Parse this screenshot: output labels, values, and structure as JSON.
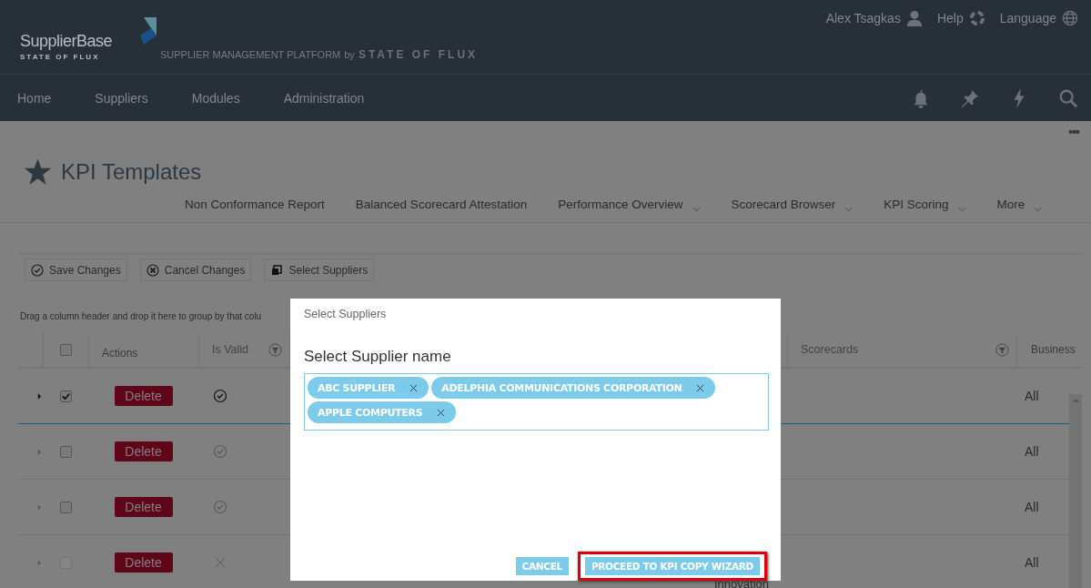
{
  "header": {
    "logo": {
      "name": "SupplierBase",
      "sub": "STATE OF FLUX"
    },
    "tagline": "SUPPLIER MANAGEMENT PLATFORM",
    "tagline_by": "by",
    "tagline_brand": "STATE OF FLUX",
    "user_links": [
      "Alex Tsagkas",
      "Help",
      "Language"
    ]
  },
  "nav": {
    "items": [
      "Home",
      "Suppliers",
      "Modules",
      "Administration"
    ]
  },
  "page": {
    "more": "•••",
    "title": "KPI Templates",
    "tabs": [
      {
        "label": "Non Conformance Report",
        "has_menu": false
      },
      {
        "label": "Balanced Scorecard Attestation",
        "has_menu": false
      },
      {
        "label": "Performance Overview",
        "has_menu": true
      },
      {
        "label": "Scorecard Browser",
        "has_menu": true
      },
      {
        "label": "KPI Scoring",
        "has_menu": true
      },
      {
        "label": "More",
        "has_menu": true
      }
    ],
    "toolbar": [
      "Save Changes",
      "Cancel Changes",
      "Select Suppliers"
    ],
    "group_hint": "Drag a column header and drop it here to group by that colu"
  },
  "table": {
    "all_checked": false,
    "columns": [
      {
        "label": "Actions",
        "filter": false
      },
      {
        "label": "Is Valid",
        "filter": true
      },
      {
        "label": "Scorecards",
        "filter": true
      },
      {
        "label": "Business"
      }
    ],
    "rows": [
      {
        "checked": true,
        "selected": true,
        "disabled": false,
        "action": "Delete",
        "valid": true,
        "business": "All"
      },
      {
        "checked": false,
        "selected": false,
        "disabled": false,
        "action": "Delete",
        "valid": true,
        "business": "All"
      },
      {
        "checked": false,
        "selected": false,
        "disabled": false,
        "action": "Delete",
        "valid": true,
        "business": "All"
      },
      {
        "checked": false,
        "selected": false,
        "disabled": true,
        "action": "Delete",
        "valid": false,
        "business": "All",
        "note": "Innovation"
      }
    ]
  },
  "dialog": {
    "title": "Select Suppliers",
    "field_label": "Select Supplier name",
    "tags": [
      "ABC SUPPLIER",
      "ADELPHIA COMMUNICATIONS CORPORATION",
      "APPLE COMPUTERS"
    ],
    "cancel": "CANCEL",
    "proceed": "PROCEED TO KPI COPY WIZARD",
    "proceed_highlighted": true
  }
}
